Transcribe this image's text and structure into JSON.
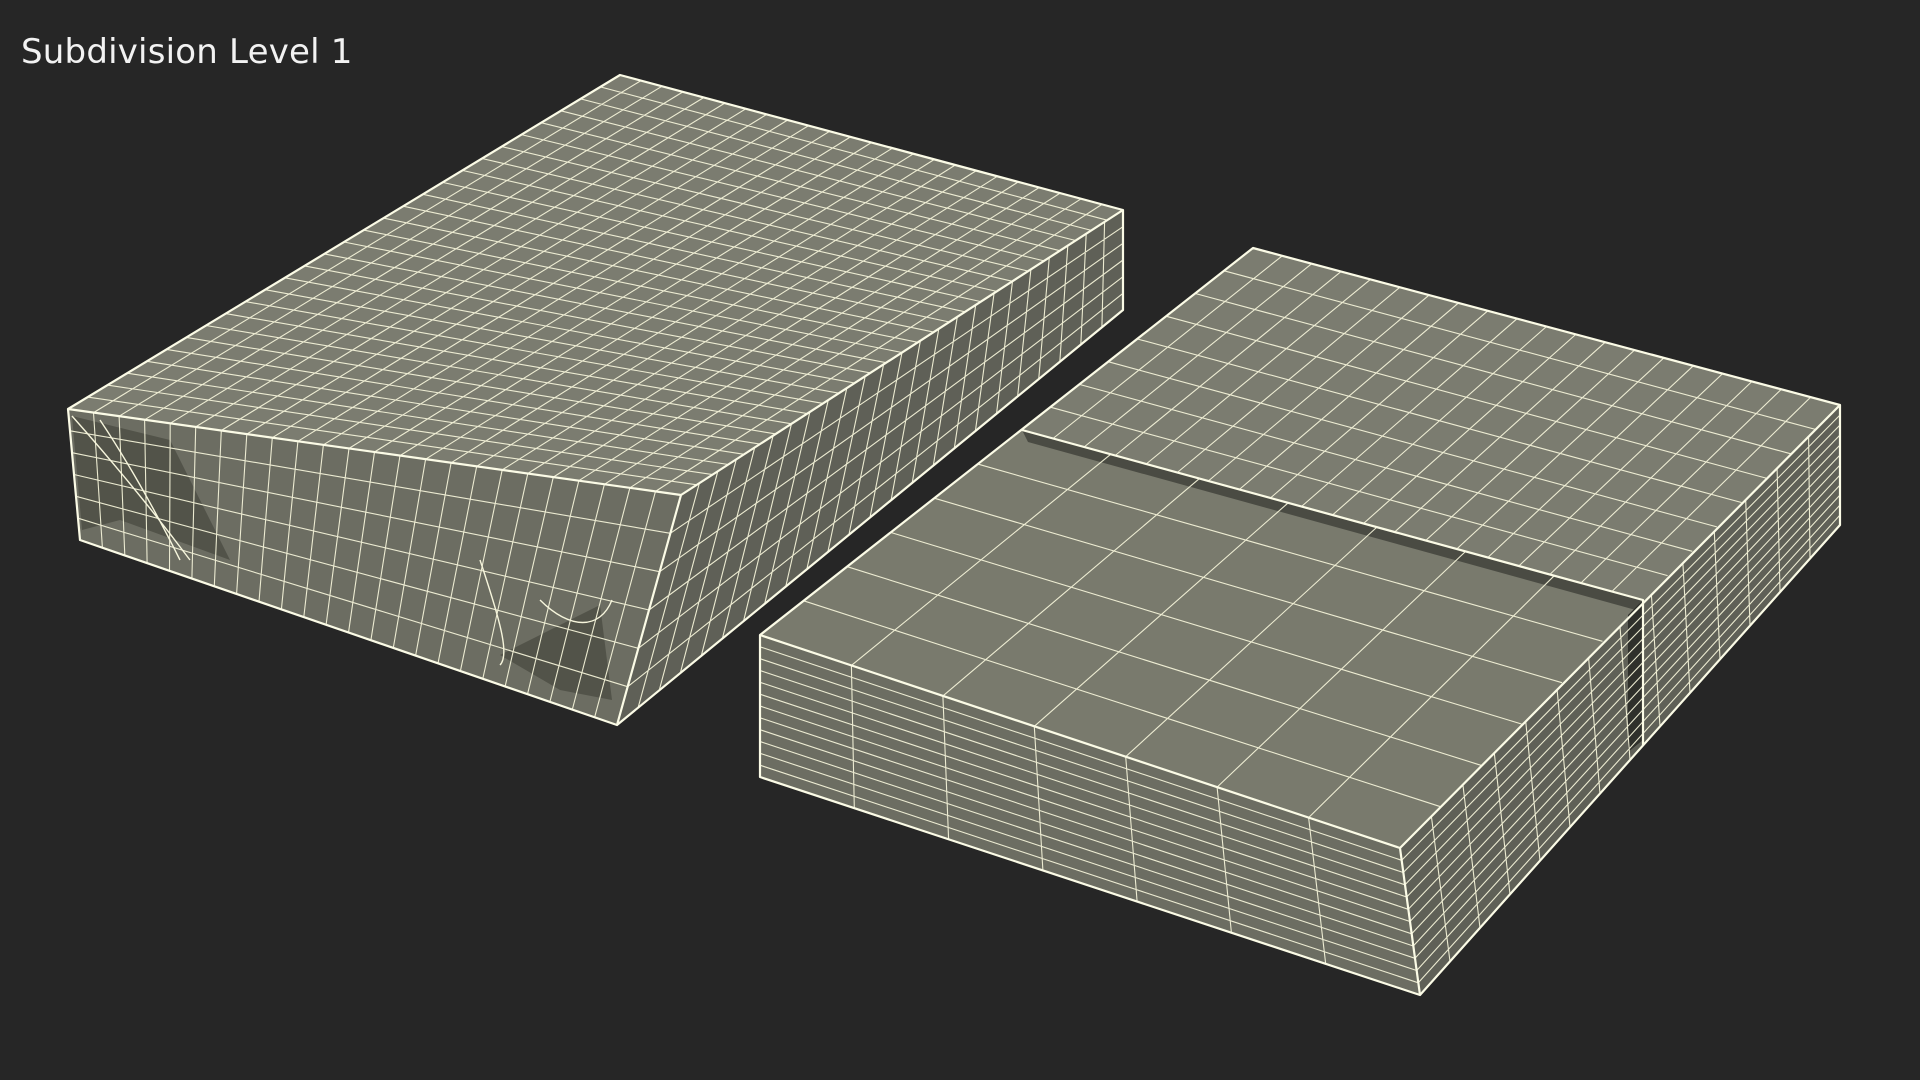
{
  "viewport": {
    "label": "Subdivision Level 1",
    "background_color": "#262626",
    "wire_color": "#f3f2d8",
    "surface_color": "#7b7c70"
  },
  "scene": {
    "objects": [
      {
        "name": "wrapped-paper-ream",
        "style": "wireframe-on-shaded"
      },
      {
        "name": "paper-ream-with-band",
        "style": "wireframe-on-shaded"
      }
    ]
  }
}
